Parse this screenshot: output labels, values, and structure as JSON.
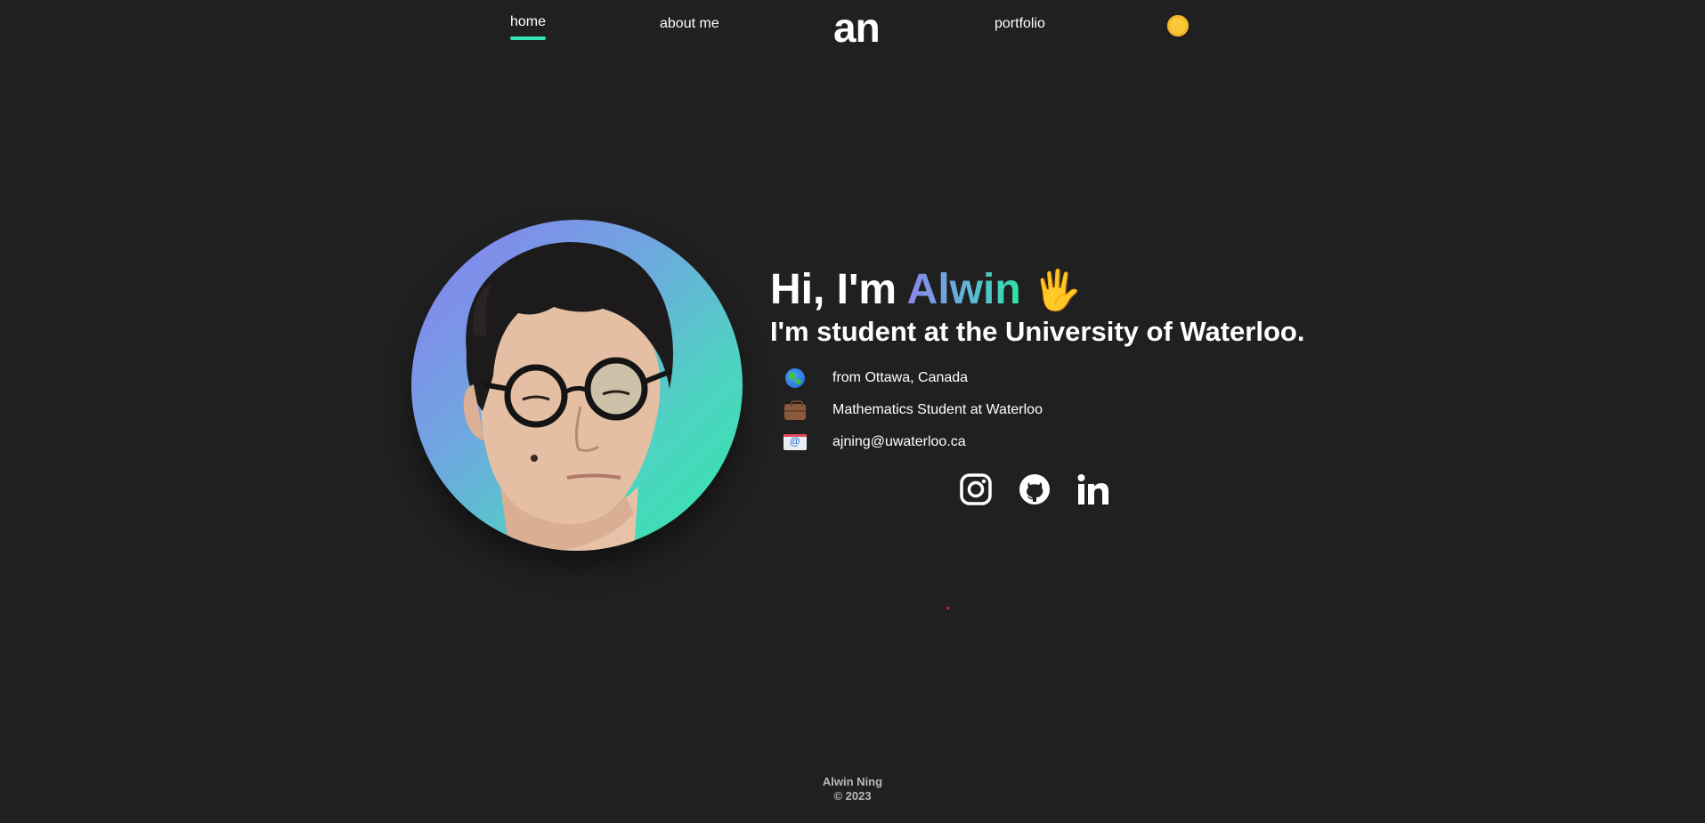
{
  "nav": {
    "home": "home",
    "about": "about me",
    "logo": "an",
    "portfolio": "portfolio",
    "theme_icon": "sun-icon",
    "active_color": "#34e3b0"
  },
  "hero": {
    "greeting_prefix": "Hi, I'm",
    "name": "Alwin",
    "wave": "🖐",
    "subtitle": "I'm student at the University of Waterloo.",
    "info": [
      {
        "icon": "globe-icon",
        "text": "from Ottawa, Canada"
      },
      {
        "icon": "briefcase-icon",
        "text": "Mathematics Student at Waterloo"
      },
      {
        "icon": "email-icon",
        "text": "ajning@uwaterloo.ca"
      }
    ],
    "social": [
      "instagram-icon",
      "github-icon",
      "linkedin-icon"
    ]
  },
  "footer": {
    "name": "Alwin Ning",
    "copyright": "© 2023"
  },
  "colors": {
    "background": "#202020",
    "accent": "#34e3b0",
    "gradient_start": "#8a7cf2",
    "gradient_end": "#2fe8a8"
  }
}
